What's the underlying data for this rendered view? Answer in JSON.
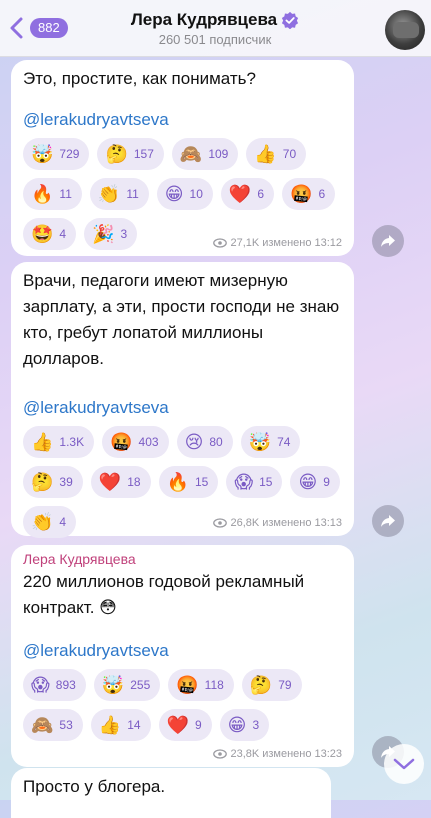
{
  "header": {
    "back_badge": "882",
    "title": "Лера Кудрявцева",
    "subtitle": "260 501 подписчик"
  },
  "messages": [
    {
      "author": "",
      "text": "Это, простите, как понимать?",
      "mention": "@lerakudryavtseva",
      "reactions": [
        {
          "emoji": "🤯",
          "count": "729"
        },
        {
          "emoji": "🤔",
          "count": "157"
        },
        {
          "emoji": "🙈",
          "count": "109"
        },
        {
          "emoji": "👍",
          "count": "70"
        },
        {
          "emoji": "🔥",
          "count": "11"
        },
        {
          "emoji": "👏",
          "count": "11"
        },
        {
          "emoji": "😁",
          "count": "10"
        },
        {
          "emoji": "❤️",
          "count": "6"
        },
        {
          "emoji": "🤬",
          "count": "6"
        },
        {
          "emoji": "🤩",
          "count": "4"
        },
        {
          "emoji": "🎉",
          "count": "3"
        }
      ],
      "views": "27,1K",
      "edited": "изменено",
      "time": "13:12"
    },
    {
      "author": "",
      "text": "Врачи, педагоги имеют мизерную зарплату, а эти, прости господи не знаю кто, гребут лопатой миллионы долларов.",
      "mention": "@lerakudryavtseva",
      "reactions": [
        {
          "emoji": "👍",
          "count": "1.3K"
        },
        {
          "emoji": "🤬",
          "count": "403"
        },
        {
          "emoji": "😢",
          "count": "80"
        },
        {
          "emoji": "🤯",
          "count": "74"
        },
        {
          "emoji": "🤔",
          "count": "39"
        },
        {
          "emoji": "❤️",
          "count": "18"
        },
        {
          "emoji": "🔥",
          "count": "15"
        },
        {
          "emoji": "😱",
          "count": "15"
        },
        {
          "emoji": "😁",
          "count": "9"
        },
        {
          "emoji": "👏",
          "count": "4"
        }
      ],
      "views": "26,8K",
      "edited": "изменено",
      "time": "13:13"
    },
    {
      "author": "Лера Кудрявцева",
      "text": "220 миллионов годовой рекламный контракт. 😳",
      "mention": "@lerakudryavtseva",
      "reactions": [
        {
          "emoji": "😱",
          "count": "893"
        },
        {
          "emoji": "🤯",
          "count": "255"
        },
        {
          "emoji": "🤬",
          "count": "118"
        },
        {
          "emoji": "🤔",
          "count": "79"
        },
        {
          "emoji": "🙈",
          "count": "53"
        },
        {
          "emoji": "👍",
          "count": "14"
        },
        {
          "emoji": "❤️",
          "count": "9"
        },
        {
          "emoji": "😁",
          "count": "3"
        }
      ],
      "views": "23,8K",
      "edited": "изменено",
      "time": "13:23"
    },
    {
      "text": "Просто у блогера."
    }
  ],
  "icons": {
    "back": "chevron-left-icon",
    "verified": "verified-badge-icon",
    "views": "eye-icon",
    "share": "share-arrow-icon",
    "scroll_down": "chevron-down-icon"
  },
  "colors": {
    "accent": "#8f6fe0",
    "link": "#2d77c9",
    "reaction_bg": "#ece8f6",
    "author": "#c0417b"
  }
}
